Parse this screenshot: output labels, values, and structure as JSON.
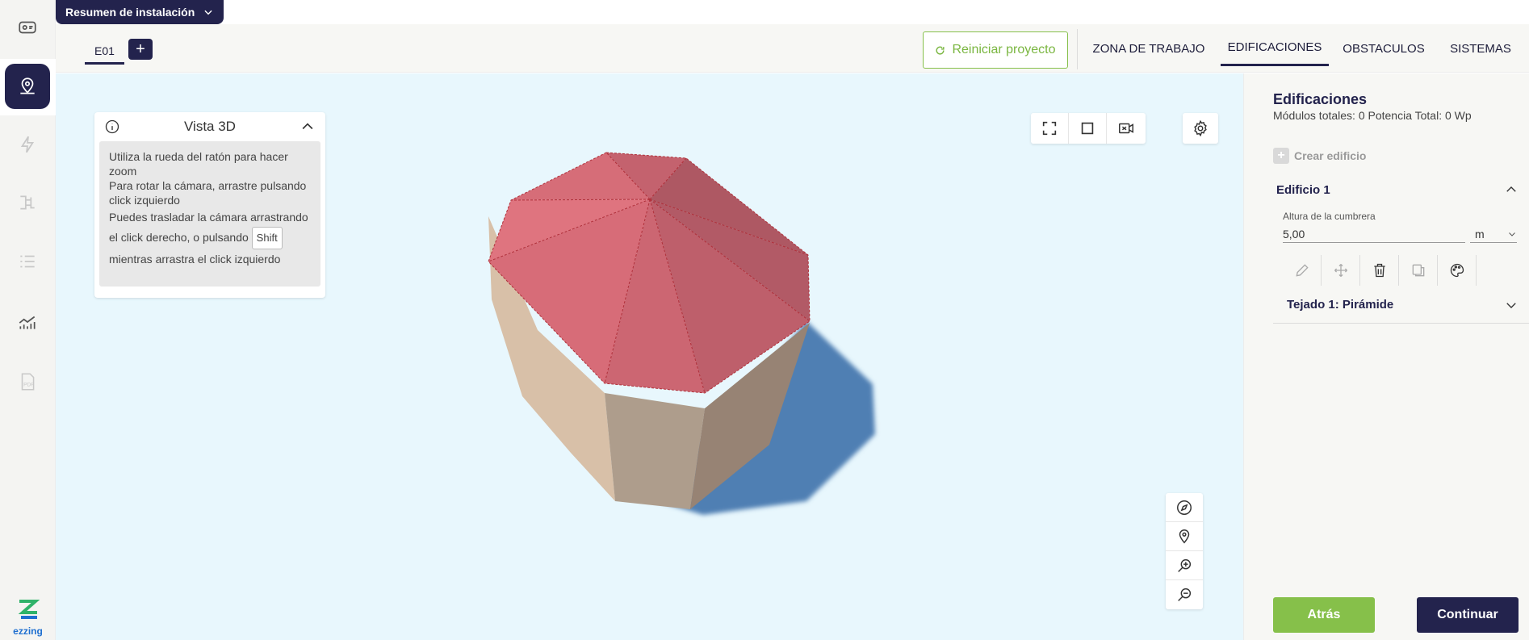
{
  "summary": {
    "label": "Resumen de instalación"
  },
  "header": {
    "building_tab": "E01",
    "add_label": "+",
    "reset_label": "Reiniciar proyecto",
    "tabs": [
      {
        "label": "ZONA DE TRABAJO",
        "active": false
      },
      {
        "label": "EDIFICACIONES",
        "active": true
      },
      {
        "label": "OBSTACULOS",
        "active": false
      },
      {
        "label": "SISTEMAS",
        "active": false
      }
    ]
  },
  "sidebar": {
    "items": [
      {
        "icon": "dashboard-icon",
        "active": false
      },
      {
        "icon": "location-pin-icon",
        "active": true
      },
      {
        "icon": "lightning-icon",
        "active": false
      },
      {
        "icon": "wiring-icon",
        "active": false
      },
      {
        "icon": "list-icon",
        "active": false
      },
      {
        "icon": "chart-icon",
        "active": false
      },
      {
        "icon": "pdf-icon",
        "active": false
      }
    ],
    "brand": "ezzing"
  },
  "info_card": {
    "title": "Vista 3D",
    "line1": "Utiliza la rueda del ratón para hacer zoom",
    "line2": "Para rotar la cámara, arrastre pulsando click izquierdo",
    "line3a": "Puedes trasladar la cámara arrastrando el click derecho, o pulsando",
    "key": "Shift",
    "line3b": "mientras arrastra el click izquierdo"
  },
  "panel": {
    "title": "Edificaciones",
    "subtitle": "Módulos totales: 0 Potencia Total: 0 Wp",
    "create_label": "Crear edificio",
    "building_name": "Edificio 1",
    "field_label": "Altura de la cumbrera",
    "field_value": "5,00",
    "unit": "m",
    "roof_label": "Tejado 1: Pirámide",
    "back_label": "Atrás",
    "continue_label": "Continuar"
  },
  "colors": {
    "navy": "#23234d",
    "green": "#86c04a",
    "viewport_bg": "#e8f7fd",
    "roof": "#d9707a",
    "walls": "#cdb39f",
    "shadow": "#4f7fb3"
  }
}
